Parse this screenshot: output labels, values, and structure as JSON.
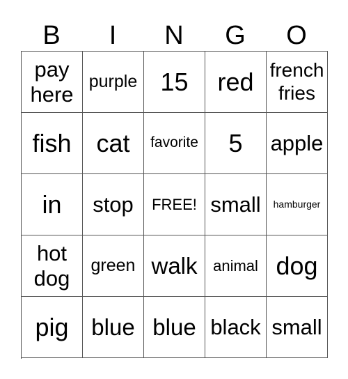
{
  "header": [
    "B",
    "I",
    "N",
    "G",
    "O"
  ],
  "cells": [
    [
      "pay here",
      "purple",
      "15",
      "red",
      "french fries"
    ],
    [
      "fish",
      "cat",
      "favorite",
      "5",
      "apple"
    ],
    [
      "in",
      "stop",
      "FREE!",
      "small",
      "hamburger"
    ],
    [
      "hot dog",
      "green",
      "walk",
      "animal",
      "dog"
    ],
    [
      "pig",
      "blue",
      "blue",
      "black",
      "small"
    ]
  ]
}
